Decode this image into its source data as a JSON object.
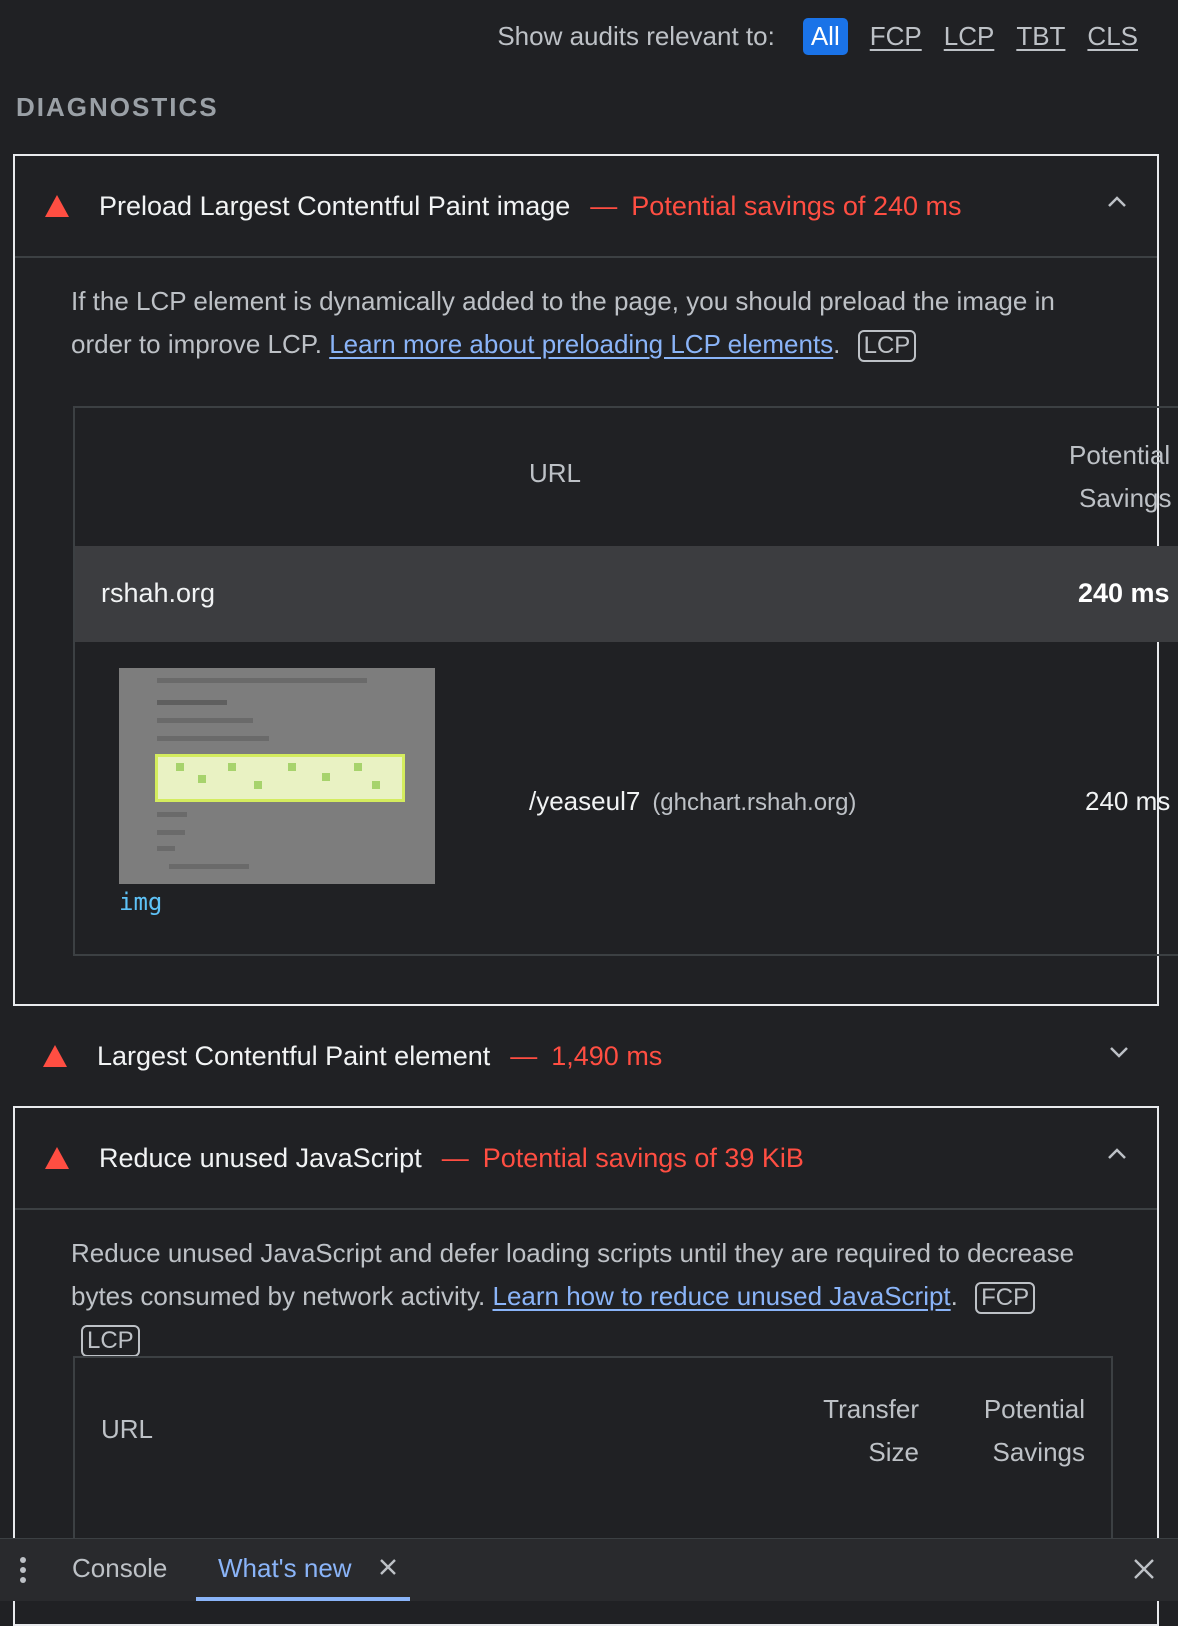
{
  "filter": {
    "label": "Show audits relevant to:",
    "options": [
      "All",
      "FCP",
      "LCP",
      "TBT",
      "CLS"
    ],
    "active": "All"
  },
  "section_title": "DIAGNOSTICS",
  "audits": [
    {
      "title": "Preload Largest Contentful Paint image",
      "separator": "—",
      "value": "Potential savings of 240 ms",
      "description": "If the LCP element is dynamically added to the page, you should preload the image in order to improve LCP.",
      "link": "Learn more about preloading LCP elements",
      "tags": [
        "LCP"
      ],
      "table": {
        "headers": {
          "url": "URL",
          "savings_line1": "Potential",
          "savings_line2": "Savings"
        },
        "group": {
          "host": "rshah.org",
          "savings": "240 ms"
        },
        "item": {
          "node": "img",
          "path": "/yeaseul7",
          "host": "(ghchart.rshah.org)",
          "savings": "240 ms"
        }
      }
    },
    {
      "title": "Largest Contentful Paint element",
      "separator": "—",
      "value": "1,490 ms"
    },
    {
      "title": "Reduce unused JavaScript",
      "separator": "—",
      "value": "Potential savings of 39 KiB",
      "description": "Reduce unused JavaScript and defer loading scripts until they are required to decrease bytes consumed by network activity.",
      "link": "Learn how to reduce unused JavaScript",
      "tags": [
        "FCP",
        "LCP"
      ],
      "table": {
        "headers": {
          "url": "URL",
          "transfer_line1": "Transfer",
          "transfer_line2": "Size",
          "savings_line1": "Potential",
          "savings_line2": "Savings"
        }
      }
    }
  ],
  "drawer": {
    "tabs": [
      "Console",
      "What's new"
    ],
    "active": "What's new"
  },
  "colors": {
    "fail": "#ff4e42",
    "link": "#8ab4f8",
    "accent": "#1a73e8"
  }
}
